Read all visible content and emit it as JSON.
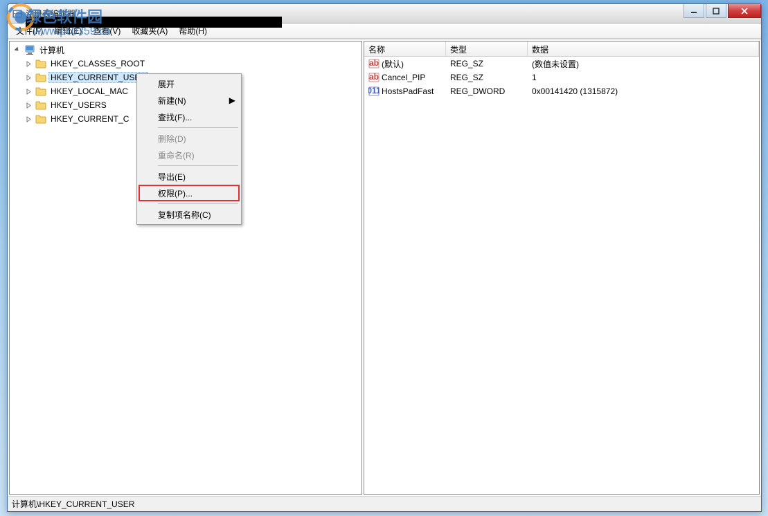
{
  "window": {
    "title": "注册表编辑器"
  },
  "watermark": {
    "text": "绿色软件园",
    "url": "www.pc0359.cn"
  },
  "menubar": [
    {
      "label": "文件(F)"
    },
    {
      "label": "编辑(E)"
    },
    {
      "label": "查看(V)"
    },
    {
      "label": "收藏夹(A)"
    },
    {
      "label": "帮助(H)"
    }
  ],
  "tree": {
    "root": "计算机",
    "children": [
      {
        "label": "HKEY_CLASSES_ROOT",
        "selected": false
      },
      {
        "label": "HKEY_CURRENT_USER",
        "selected": true
      },
      {
        "label": "HKEY_LOCAL_MAC",
        "selected": false
      },
      {
        "label": "HKEY_USERS",
        "selected": false
      },
      {
        "label": "HKEY_CURRENT_C",
        "selected": false
      }
    ]
  },
  "list": {
    "columns": {
      "name": "名称",
      "type": "类型",
      "data": "数据"
    },
    "rows": [
      {
        "icon": "string",
        "name": "(默认)",
        "type": "REG_SZ",
        "data": "(数值未设置)"
      },
      {
        "icon": "string",
        "name": "Cancel_PIP",
        "type": "REG_SZ",
        "data": "1"
      },
      {
        "icon": "binary",
        "name": "HostsPadFast",
        "type": "REG_DWORD",
        "data": "0x00141420 (1315872)"
      }
    ]
  },
  "context_menu": [
    {
      "label": "展开",
      "type": "item"
    },
    {
      "label": "新建(N)",
      "type": "submenu"
    },
    {
      "label": "查找(F)...",
      "type": "item"
    },
    {
      "type": "sep"
    },
    {
      "label": "删除(D)",
      "type": "item",
      "disabled": true
    },
    {
      "label": "重命名(R)",
      "type": "item",
      "disabled": true
    },
    {
      "type": "sep"
    },
    {
      "label": "导出(E)",
      "type": "item"
    },
    {
      "label": "权限(P)...",
      "type": "item",
      "highlighted": true
    },
    {
      "type": "sep"
    },
    {
      "label": "复制项名称(C)",
      "type": "item"
    }
  ],
  "statusbar": {
    "path": "计算机\\HKEY_CURRENT_USER"
  }
}
